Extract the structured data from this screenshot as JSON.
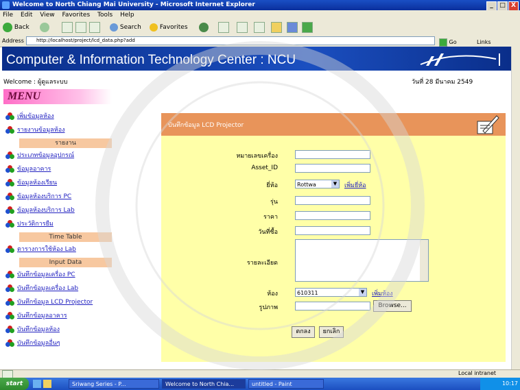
{
  "window": {
    "title": "Welcome to North Chiang Mai University - Microsoft Internet Explorer",
    "controls": [
      "_",
      "□",
      "X"
    ]
  },
  "menubar": [
    "File",
    "Edit",
    "View",
    "Favorites",
    "Tools",
    "Help"
  ],
  "toolbar": {
    "back": "Back",
    "search": "Search",
    "favorites": "Favorites"
  },
  "addressbar": {
    "label": "Address",
    "url": "http://localhost/project/lcd_data.php?add",
    "go": "Go",
    "links": "Links"
  },
  "banner": {
    "title": "Computer & Information Technology Center : NCU"
  },
  "page": {
    "welcome": "Welcome : ผู้ดูแลระบบ",
    "date": "วันที่ 28 มีนาคม 2549"
  },
  "menu": {
    "header": "MENU",
    "items": [
      {
        "label": "เพิ่มข้อมูลห้อง",
        "type": "link"
      },
      {
        "label": "รายงานข้อมูลห้อง",
        "type": "link"
      },
      {
        "label": "รายงาน",
        "type": "section"
      },
      {
        "label": "ประเภทข้อมูลอุปกรณ์",
        "type": "link"
      },
      {
        "label": "ข้อมูลอาคาร",
        "type": "link"
      },
      {
        "label": "ข้อมูลห้องเรียน",
        "type": "link"
      },
      {
        "label": "ข้อมูลห้องบริการ PC",
        "type": "link"
      },
      {
        "label": "ข้อมูลห้องบริการ Lab",
        "type": "link"
      },
      {
        "label": "ประวัติการยืม",
        "type": "link"
      },
      {
        "label": "Time Table",
        "type": "section"
      },
      {
        "label": "ตารางการใช้ห้อง Lab",
        "type": "link"
      },
      {
        "label": "Input Data",
        "type": "section"
      },
      {
        "label": "บันทึกข้อมูลเครื่อง PC",
        "type": "link"
      },
      {
        "label": "บันทึกข้อมูลเครื่อง Lab",
        "type": "link"
      },
      {
        "label": "บันทึกข้อมูล LCD Projector",
        "type": "link"
      },
      {
        "label": "บันทึกข้อมูลอาคาร",
        "type": "link"
      },
      {
        "label": "บันทึกข้อมูลห้อง",
        "type": "link"
      },
      {
        "label": "บันทึกข้อมูลอื่นๆ",
        "type": "link"
      }
    ]
  },
  "form": {
    "title": "บันทึกข้อมูล LCD Projector",
    "fields": [
      {
        "label": "หมายเลขเครื่อง",
        "value": "",
        "kind": "text"
      },
      {
        "label": "Asset_ID",
        "value": "",
        "kind": "text"
      },
      {
        "label": "ยี่ห้อ",
        "value": "Rottwa",
        "kind": "select",
        "link": "เพิ่มยี่ห้อ"
      },
      {
        "label": "รุ่น",
        "value": "",
        "kind": "text"
      },
      {
        "label": "ราคา",
        "value": "",
        "kind": "text"
      },
      {
        "label": "วันที่ซื้อ",
        "value": "",
        "kind": "text"
      },
      {
        "label": "รายละเอียด",
        "value": "",
        "kind": "textarea"
      },
      {
        "label": "ห้อง",
        "value": "610311",
        "kind": "select",
        "link": "เพิ่มห้อง"
      },
      {
        "label": "รูปภาพ",
        "value": "",
        "kind": "file",
        "button": "Browse..."
      }
    ],
    "buttons": {
      "save": "ตกลง",
      "reset": "ยกเลิก"
    }
  },
  "statusbar": {
    "zone": "Local intranet"
  },
  "taskbar": {
    "start": "start",
    "tasks": [
      {
        "label": "Sriwang Series - P..."
      },
      {
        "label": "Welcome to North Chia..."
      },
      {
        "label": "untitled - Paint"
      }
    ],
    "clock": "10:17"
  }
}
